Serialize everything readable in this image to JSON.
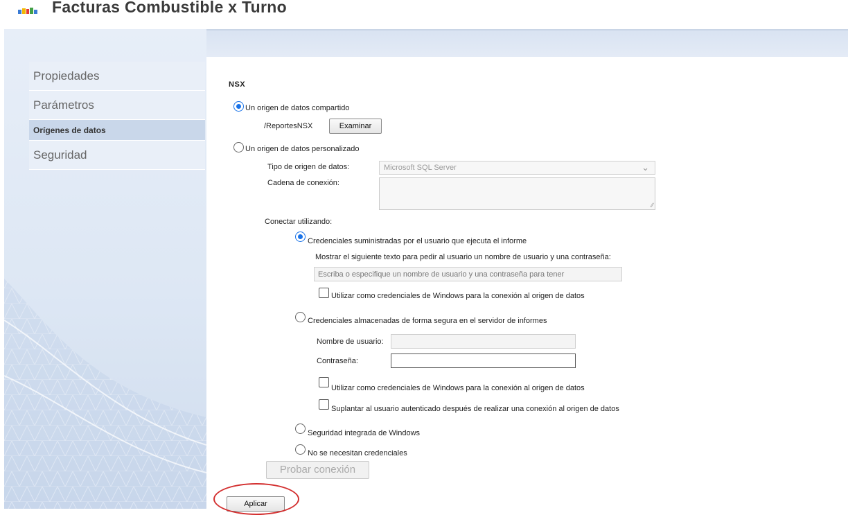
{
  "header": {
    "title": "Facturas Combustible x Turno",
    "logo_colors": [
      "#3a7bd5",
      "#f2b705",
      "#e53935",
      "#43a047"
    ]
  },
  "sidebar": {
    "items": [
      {
        "label": "Propiedades"
      },
      {
        "label": "Parámetros"
      },
      {
        "label": "Orígenes de datos",
        "selected": true
      },
      {
        "label": "Seguridad"
      }
    ]
  },
  "main": {
    "datasource_name": "NSX",
    "shared": {
      "label": "Un origen de datos compartido",
      "checked": true,
      "path": "/ReportesNSX",
      "browse_label": "Examinar"
    },
    "custom": {
      "label": "Un origen de datos personalizado",
      "checked": false,
      "type_label": "Tipo de origen de datos:",
      "type_value": "Microsoft SQL Server",
      "connection_label": "Cadena de conexión:",
      "connection_value": ""
    },
    "connect_using_label": "Conectar utilizando:",
    "cred_user": {
      "label": "Credenciales suministradas por el usuario que ejecuta el informe",
      "checked": true,
      "prompt_label": "Mostrar el siguiente texto para pedir al usuario un nombre de usuario y una contraseña:",
      "prompt_value": "Escriba o especifique un nombre de usuario y una contraseña para tener",
      "windows_label": "Utilizar como credenciales de Windows para la conexión al origen de datos"
    },
    "cred_stored": {
      "label": "Credenciales almacenadas de forma segura en el servidor de informes",
      "checked": false,
      "username_label": "Nombre de usuario:",
      "username_value": "",
      "password_label": "Contraseña:",
      "password_value": "",
      "windows_label": "Utilizar como credenciales de Windows para la conexión al origen de datos",
      "impersonate_label": "Suplantar al usuario autenticado después de realizar una conexión al origen de datos"
    },
    "integrated_label": "Seguridad integrada de Windows",
    "none_label": "No se necesitan credenciales",
    "test_label": "Probar conexión",
    "apply_label": "Aplicar"
  },
  "colors": {
    "accent": "#1a73e8",
    "annotation": "#d32f2f"
  }
}
